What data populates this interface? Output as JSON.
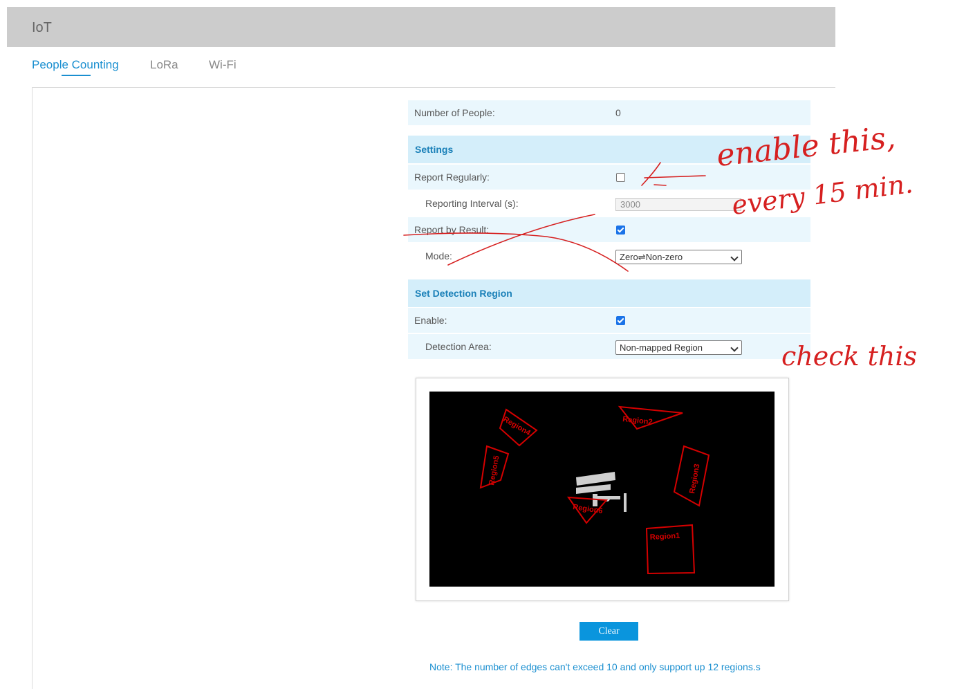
{
  "header": {
    "title": "IoT"
  },
  "tabs": [
    {
      "label": "People Counting",
      "active": true
    },
    {
      "label": "LoRa",
      "active": false
    },
    {
      "label": "Wi-Fi",
      "active": false
    }
  ],
  "status": {
    "number_of_people_label": "Number of People:",
    "number_of_people_value": "0"
  },
  "settings": {
    "section_title": "Settings",
    "report_regularly_label": "Report Regularly:",
    "report_regularly_checked": false,
    "reporting_interval_label": "Reporting Interval (s):",
    "reporting_interval_value": "3000",
    "report_by_result_label": "Report by Result:",
    "report_by_result_checked": true,
    "mode_label": "Mode:",
    "mode_value": "Zero⇌Non-zero"
  },
  "detection": {
    "section_title": "Set Detection Region",
    "enable_label": "Enable:",
    "enable_checked": true,
    "area_label": "Detection Area:",
    "area_value": "Non-mapped Region",
    "regions": [
      "Region1",
      "Region2",
      "Region3",
      "Region4",
      "Region5",
      "Region6"
    ]
  },
  "clear_label": "Clear",
  "note": "Note: The number of edges can't exceed 10 and only support up 12 regions.s",
  "annotations": {
    "enable_note_line1": "enable this,",
    "enable_note_line2": "every 15 min.",
    "check_note": "check this"
  },
  "colors": {
    "accent": "#1a8fd0",
    "region": "#d40000",
    "annotation": "#d62020"
  }
}
